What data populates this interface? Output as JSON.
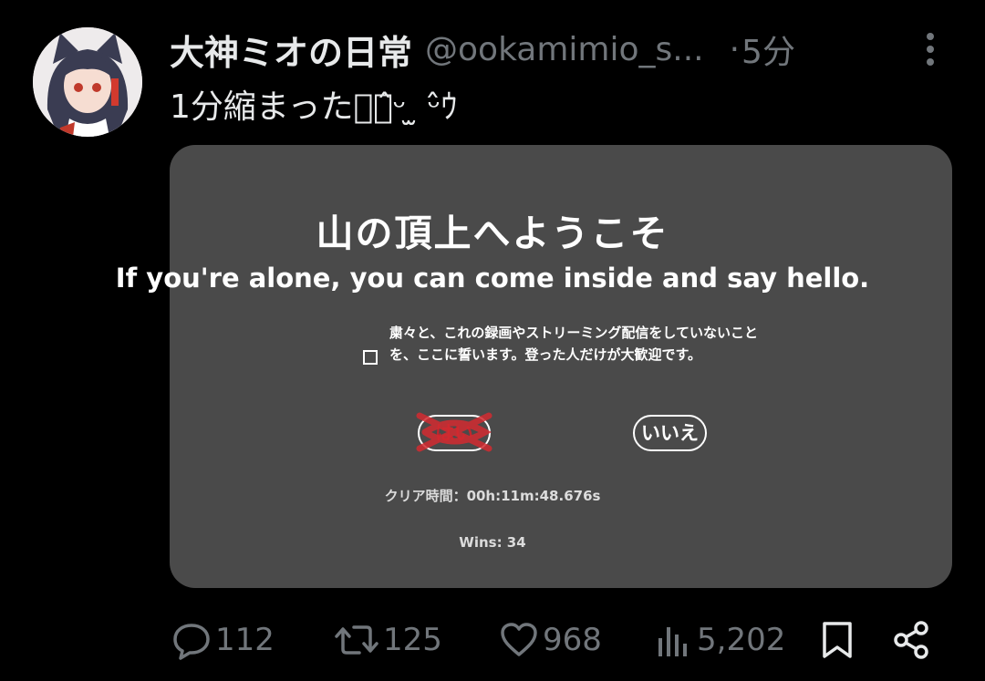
{
  "tweet": {
    "display_name": "大神ミオの日常",
    "handle": "@ookamimio_s...",
    "separator": "·",
    "time": "5分",
    "text": "1分縮まったﾋﾞ̂ᵕ ̫ ᵕ̂ｳ"
  },
  "media": {
    "title": "山の頂上へようこそ",
    "subtitle": "If you're alone, you can come inside and say hello.",
    "pledge": "粛々と、これの録画やストリーミング配信をしていないことを、ここに誓います。登った人だけが大歓迎です。",
    "yes_label": "はい",
    "no_label": "いいえ",
    "clear_time": "クリア時間：00h:11m:48.676s",
    "wins": "Wins: 34"
  },
  "actions": {
    "replies": "112",
    "retweets": "125",
    "likes": "968",
    "views": "5,202"
  },
  "icons": {
    "more": "more-vertical-icon",
    "reply": "reply-icon",
    "retweet": "retweet-icon",
    "like": "heart-icon",
    "views": "views-icon",
    "bookmark": "bookmark-icon",
    "share": "share-icon"
  },
  "colors": {
    "background": "#000000",
    "text": "#e7e9ea",
    "muted": "#71767b",
    "card": "#4a4a4a",
    "scribble": "#c3252d"
  }
}
